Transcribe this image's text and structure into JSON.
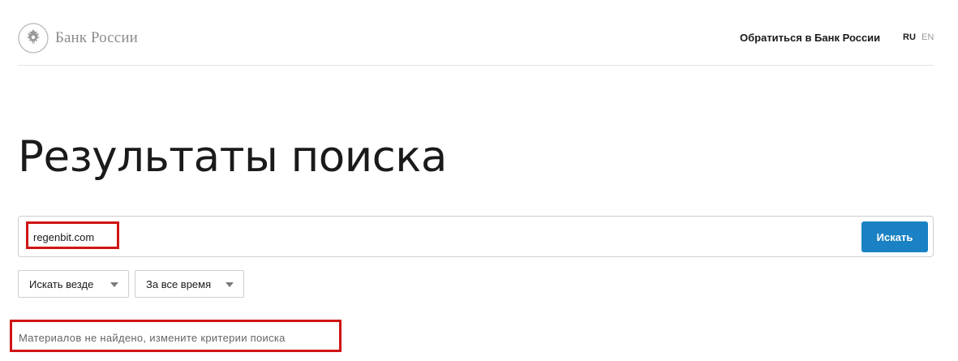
{
  "header": {
    "logo_text": "Банк России",
    "contact_link": "Обратиться в Банк России",
    "lang_ru": "RU",
    "lang_en": "EN"
  },
  "page_title": "Результаты поиска",
  "search": {
    "value": "regenbit.com",
    "button_label": "Искать"
  },
  "filters": {
    "area": "Искать везде",
    "period": "За все время"
  },
  "results": {
    "message": "Материалов не найдено, измените критерии поиска"
  },
  "colors": {
    "accent": "#1a82c4",
    "highlight": "#d01414"
  }
}
